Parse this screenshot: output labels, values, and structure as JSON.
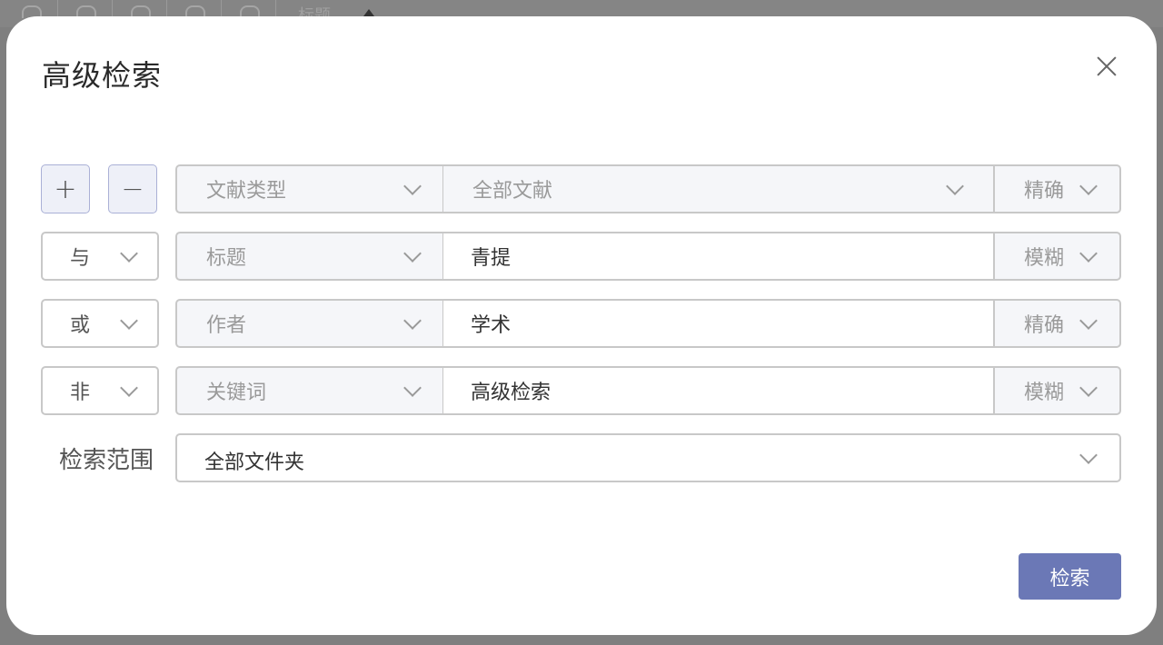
{
  "background": {
    "title": "标题"
  },
  "dialog": {
    "title": "高级检索",
    "close_icon": "close-icon"
  },
  "controls": {
    "add_label": "+",
    "remove_label": "−"
  },
  "first_row": {
    "field": "文献类型",
    "value": "全部文献",
    "mode": "精确"
  },
  "rows": [
    {
      "logic": "与",
      "field": "标题",
      "value": "青提",
      "mode": "模糊"
    },
    {
      "logic": "或",
      "field": "作者",
      "value": "学术",
      "mode": "精确"
    },
    {
      "logic": "非",
      "field": "关键词",
      "value": "高级检索",
      "mode": "模糊"
    }
  ],
  "scope": {
    "label": "检索范围",
    "value": "全部文件夹"
  },
  "actions": {
    "search_label": "检索"
  },
  "colors": {
    "primary": "#6b78b6",
    "button_light_bg": "#eef0f8",
    "button_light_border": "#aab0d6"
  }
}
